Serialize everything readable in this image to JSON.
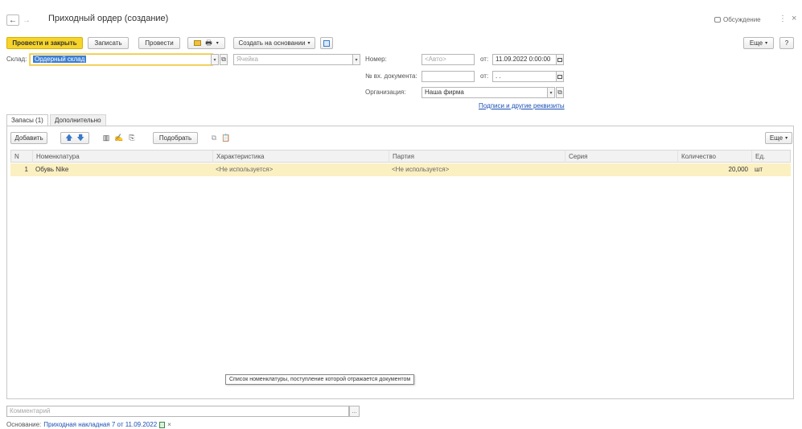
{
  "window": {
    "title": "Приходный ордер (создание)",
    "discussions_label": "Обсуждение",
    "more_label": "⋮",
    "close_label": "×"
  },
  "toolbar": {
    "post_close": "Провести и закрыть",
    "save": "Записать",
    "post": "Провести",
    "create_based": "Создать на основании",
    "more": "Еще",
    "help": "?"
  },
  "form": {
    "warehouse_label": "Склад:",
    "warehouse_value": "Ордерный склад",
    "cell_placeholder": "Ячейка",
    "number_label": "Номер:",
    "number_value": "<Авто>",
    "date_from_label": "от:",
    "date_value": "11.09.2022  0:00:00",
    "incoming_doc_label": "№ вх. документа:",
    "incoming_doc_value": "",
    "incoming_date_label": "от:",
    "incoming_date_value": " .  .",
    "org_label": "Организация:",
    "org_value": "Наша фирма",
    "signatures_link": "Подписи и другие реквизиты"
  },
  "tabs": [
    {
      "label": "Запасы (1)",
      "active": true
    },
    {
      "label": "Дополнительно",
      "active": false
    }
  ],
  "table_toolbar": {
    "add": "Добавить",
    "pick": "Подобрать",
    "more": "Еще"
  },
  "table": {
    "columns": [
      "N",
      "Номенклатура",
      "Характеристика",
      "Партия",
      "Серия",
      "Количество",
      "Ед."
    ],
    "rows": [
      {
        "n": "1",
        "item": "Обувь Nike",
        "characteristic": "<Не используется>",
        "batch": "<Не используется>",
        "series": "",
        "qty": "20,000",
        "unit": "шт"
      }
    ]
  },
  "tooltip": "Список номенклатуры, поступление которой отражается документом",
  "comment_placeholder": "Комментарий",
  "comment_button": "...",
  "footer": {
    "basis_label": "Основание:",
    "basis_link": "Приходная накладная 7 от 11.09.2022",
    "clear_label": "×"
  },
  "colors": {
    "accent_yellow": "#f7d42a",
    "selected_row": "#fbf0c2",
    "link_blue": "#1a4fb5"
  }
}
